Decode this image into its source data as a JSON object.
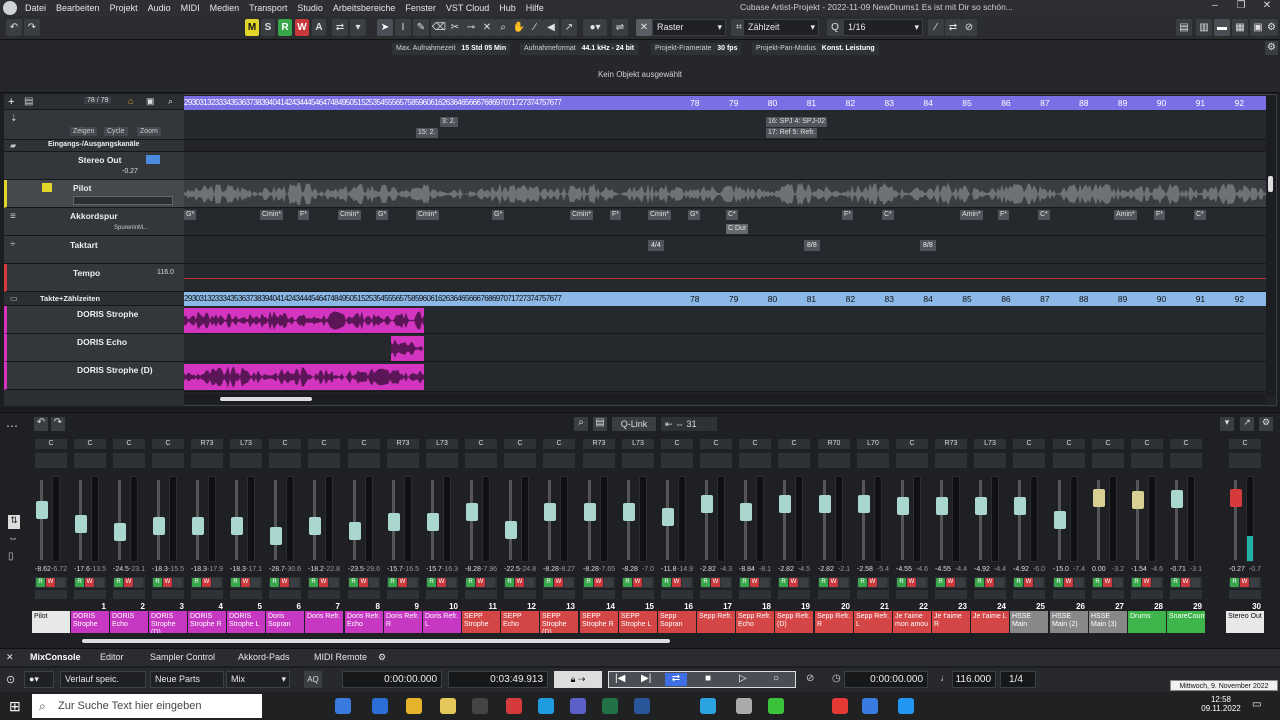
{
  "menu": [
    "Datei",
    "Bearbeiten",
    "Projekt",
    "Audio",
    "MIDI",
    "Medien",
    "Transport",
    "Studio",
    "Arbeitsbereiche",
    "Fenster",
    "VST Cloud",
    "Hub",
    "Hilfe"
  ],
  "window_title": "Cubase Artist-Projekt - 2022-11-09 NewDrums1  Es ist mit Dir so schön...",
  "toolbar": {
    "mswr": [
      "M",
      "S",
      "R",
      "W",
      "A"
    ],
    "raster": "Raster",
    "zeitbasis": "Zählzeit",
    "quantize": "1/16"
  },
  "infobar": {
    "items": [
      {
        "label": "Max. Aufnahmezeit",
        "value": "15 Std 05 Min"
      },
      {
        "label": "Aufnahmeformat",
        "value": "44.1 kHz - 24 bit"
      },
      {
        "label": "Projekt-Framerate",
        "value": "30 fps"
      },
      {
        "label": "Projekt-Pan-Modus",
        "value": "Konst. Leistung"
      }
    ]
  },
  "infoline": "Kein Objekt ausgewählt",
  "tracklist": {
    "counter": "78 / 79",
    "tracks": [
      {
        "name": "Zeigen"
      },
      {
        "name": "Cycle"
      },
      {
        "name": "Zoom"
      },
      {
        "name": "Eingangs-/Ausgangskanäle"
      },
      {
        "name": "Stereo Out"
      },
      {
        "name": "Pilot"
      },
      {
        "name": "Akkordspur"
      },
      {
        "name": "Taktart"
      },
      {
        "name": "Tempo"
      },
      {
        "name": "Takte+Zählzeiten"
      },
      {
        "name": "DORIS Strophe"
      },
      {
        "name": "DORIS Echo"
      },
      {
        "name": "DORIS Strophe (D)"
      }
    ],
    "stereo_vol": "-0.27",
    "akkord_sub": "SpureninM...",
    "tempo_val": "116.0"
  },
  "ruler_small": "29303132333435363738394041424344454647484950515253545556575859606162636465666768697071727374757677",
  "ruler_bars": [
    "78",
    "79",
    "80",
    "81",
    "82",
    "83",
    "84",
    "85",
    "86",
    "87",
    "88",
    "89",
    "90",
    "91",
    "92"
  ],
  "markers": [
    "3: 2.",
    "15: 2.",
    "16: SPJ 4: SPJ-02",
    "17: Ref 5: Refr."
  ],
  "chords": [
    {
      "t": "G*"
    },
    {
      "t": "Cmin*"
    },
    {
      "t": "F*"
    },
    {
      "t": "Cmin*"
    },
    {
      "t": "G*"
    },
    {
      "t": "Cmin*"
    },
    {
      "t": "G*"
    },
    {
      "t": "Cmin*"
    },
    {
      "t": "F*"
    },
    {
      "t": "Cmin*"
    },
    {
      "t": "G*"
    },
    {
      "t": "C*"
    },
    {
      "t": "F*"
    },
    {
      "t": "C*"
    },
    {
      "t": "Amin*"
    },
    {
      "t": "F*"
    },
    {
      "t": "C*"
    },
    {
      "t": "Amin*"
    },
    {
      "t": "F*"
    },
    {
      "t": "C*"
    }
  ],
  "chord_scale": "C Dur",
  "signatures": [
    "4/4",
    "8/8",
    "8/8"
  ],
  "mixer": {
    "link": "Q-Link",
    "count": "31",
    "channels": [
      {
        "n": "",
        "name": "Pilot",
        "pan": "C",
        "vals": [
          "-8.62",
          "-6.72"
        ],
        "color": "#e8e8e8",
        "fader": 0.62,
        "meter": 0
      },
      {
        "n": "1",
        "name": "DORIS Strophe",
        "pan": "C",
        "vals": [
          "-17.6",
          "-13.5"
        ],
        "color": "#c638c2",
        "fader": 0.45,
        "meter": 0
      },
      {
        "n": "2",
        "name": "DORIS Echo",
        "pan": "C",
        "vals": [
          "-24.5",
          "-23.1"
        ],
        "color": "#c638c2",
        "fader": 0.35,
        "meter": 0
      },
      {
        "n": "3",
        "name": "DORIS Strophe (D)",
        "pan": "C",
        "vals": [
          "-18.3",
          "-15.5"
        ],
        "color": "#c638c2",
        "fader": 0.43,
        "meter": 0
      },
      {
        "n": "4",
        "name": "DORIS Strophe R",
        "pan": "R73",
        "vals": [
          "-18.3",
          "-17.9"
        ],
        "color": "#c638c2",
        "fader": 0.43,
        "meter": 0
      },
      {
        "n": "5",
        "name": "DORIS Strophe L",
        "pan": "L73",
        "vals": [
          "-18.3",
          "-17.1"
        ],
        "color": "#c638c2",
        "fader": 0.43,
        "meter": 0
      },
      {
        "n": "6",
        "name": "Doris Sopran",
        "pan": "C",
        "vals": [
          "-28.7",
          "-30.6"
        ],
        "color": "#c638c2",
        "fader": 0.3,
        "meter": 0
      },
      {
        "n": "7",
        "name": "Doris Refr.",
        "pan": "C",
        "vals": [
          "-18.2",
          "-22.8"
        ],
        "color": "#c638c2",
        "fader": 0.43,
        "meter": 0
      },
      {
        "n": "8",
        "name": "Doris Refr. Echo",
        "pan": "C",
        "vals": [
          "-23.5",
          "-29.6"
        ],
        "color": "#c638c2",
        "fader": 0.36,
        "meter": 0
      },
      {
        "n": "9",
        "name": "Doris Refr. R",
        "pan": "R73",
        "vals": [
          "-15.7",
          "-16.5"
        ],
        "color": "#c638c2",
        "fader": 0.47,
        "meter": 0
      },
      {
        "n": "10",
        "name": "Doris Refr. L",
        "pan": "L73",
        "vals": [
          "-15.7",
          "-16.3"
        ],
        "color": "#c638c2",
        "fader": 0.47,
        "meter": 0
      },
      {
        "n": "11",
        "name": "SEPP Strophe",
        "pan": "C",
        "vals": [
          "-8.28",
          "-7.96"
        ],
        "color": "#d44646",
        "fader": 0.6,
        "meter": 0
      },
      {
        "n": "12",
        "name": "SEPP Echo",
        "pan": "C",
        "vals": [
          "-22.5",
          "-24.8"
        ],
        "color": "#d44646",
        "fader": 0.38,
        "meter": 0
      },
      {
        "n": "13",
        "name": "SEPP Strophe (D)",
        "pan": "C",
        "vals": [
          "-8.28",
          "-8.27"
        ],
        "color": "#d44646",
        "fader": 0.6,
        "meter": 0
      },
      {
        "n": "14",
        "name": "SEPP Strophe R",
        "pan": "R73",
        "vals": [
          "-8.28",
          "-7.65"
        ],
        "color": "#d44646",
        "fader": 0.6,
        "meter": 0
      },
      {
        "n": "15",
        "name": "SEPP Strophe L",
        "pan": "L73",
        "vals": [
          "-8.28",
          "-7.0"
        ],
        "color": "#d44646",
        "fader": 0.6,
        "meter": 0
      },
      {
        "n": "16",
        "name": "Sepp Sopran",
        "pan": "C",
        "vals": [
          "-11.8",
          "-14.9"
        ],
        "color": "#d44646",
        "fader": 0.54,
        "meter": 0
      },
      {
        "n": "17",
        "name": "Sepp Refr.",
        "pan": "C",
        "vals": [
          "-2.82",
          "-4.3"
        ],
        "color": "#d44646",
        "fader": 0.7,
        "meter": 0
      },
      {
        "n": "18",
        "name": "Sepp Refr. Echo",
        "pan": "C",
        "vals": [
          "-8.84",
          "-8.1"
        ],
        "color": "#d44646",
        "fader": 0.6,
        "meter": 0
      },
      {
        "n": "19",
        "name": "Sepp Refr. (D)",
        "pan": "C",
        "vals": [
          "-2.82",
          "-4.5"
        ],
        "color": "#d44646",
        "fader": 0.7,
        "meter": 0
      },
      {
        "n": "20",
        "name": "Sepp Refr. R",
        "pan": "R70",
        "vals": [
          "-2.82",
          "-2.1"
        ],
        "color": "#d44646",
        "fader": 0.7,
        "meter": 0
      },
      {
        "n": "21",
        "name": "Sepp Refr. L",
        "pan": "L70",
        "vals": [
          "-2.58",
          "-5.4"
        ],
        "color": "#d44646",
        "fader": 0.7,
        "meter": 0
      },
      {
        "n": "22",
        "name": "Je t'aime mon amou",
        "pan": "C",
        "vals": [
          "-4.55",
          "-4.6"
        ],
        "color": "#d44646",
        "fader": 0.67,
        "meter": 0
      },
      {
        "n": "23",
        "name": "Je t'aime R",
        "pan": "R73",
        "vals": [
          "-4.55",
          "-4.4"
        ],
        "color": "#d44646",
        "fader": 0.67,
        "meter": 0
      },
      {
        "n": "24",
        "name": "Je t'aime L",
        "pan": "L73",
        "vals": [
          "-4.92",
          "-4.4"
        ],
        "color": "#d44646",
        "fader": 0.67,
        "meter": 0
      },
      {
        "n": "25",
        "name": "HSSE Main",
        "pan": "C",
        "vals": [
          "-4.92",
          "-6.0"
        ],
        "color": "#888",
        "fader": 0.67,
        "meter": 0
      },
      {
        "n": "26",
        "name": "HSSE Main (2)",
        "pan": "C",
        "vals": [
          "-15.0",
          "-7.4"
        ],
        "color": "#888",
        "fader": 0.5,
        "meter": 0
      },
      {
        "n": "27",
        "name": "HSSE Main (3)",
        "pan": "C",
        "vals": [
          "0.00",
          "-3.2"
        ],
        "color": "#888",
        "fader": 0.78,
        "meter": 0
      },
      {
        "n": "28",
        "name": "Drums",
        "pan": "C",
        "vals": [
          "-1.54",
          "-4.6"
        ],
        "color": "#3db54a",
        "fader": 0.75,
        "meter": 0
      },
      {
        "n": "29",
        "name": "SnareCountryOzzie",
        "pan": "C",
        "vals": [
          "-0.71",
          "-3.1"
        ],
        "color": "#3db54a",
        "fader": 0.76,
        "meter": 0
      },
      {
        "n": "30",
        "name": "Stereo Out",
        "pan": "C",
        "vals": [
          "-0.27",
          "-0.7"
        ],
        "color": "#e8e8e8",
        "fader": 0.77,
        "meter": 0.3
      }
    ]
  },
  "mixtabs": [
    "MixConsole",
    "Editor",
    "Sampler Control",
    "Akkord-Pads",
    "MIDI Remote"
  ],
  "transport": {
    "mode": "Verlauf speic.",
    "parts": "Neue Parts",
    "mix": "Mix",
    "aq": "AQ",
    "left_locator": "0:00:00.000",
    "right_locator": "0:03:49.913",
    "position": "0:00:00.000",
    "tempo": "116.000",
    "signature": "1/4",
    "hint": "Mittwoch, 9. November 2022"
  },
  "taskbar": {
    "search_placeholder": "Zur Suche Text hier eingeben",
    "time": "12:58",
    "date": "09.11.2022"
  }
}
